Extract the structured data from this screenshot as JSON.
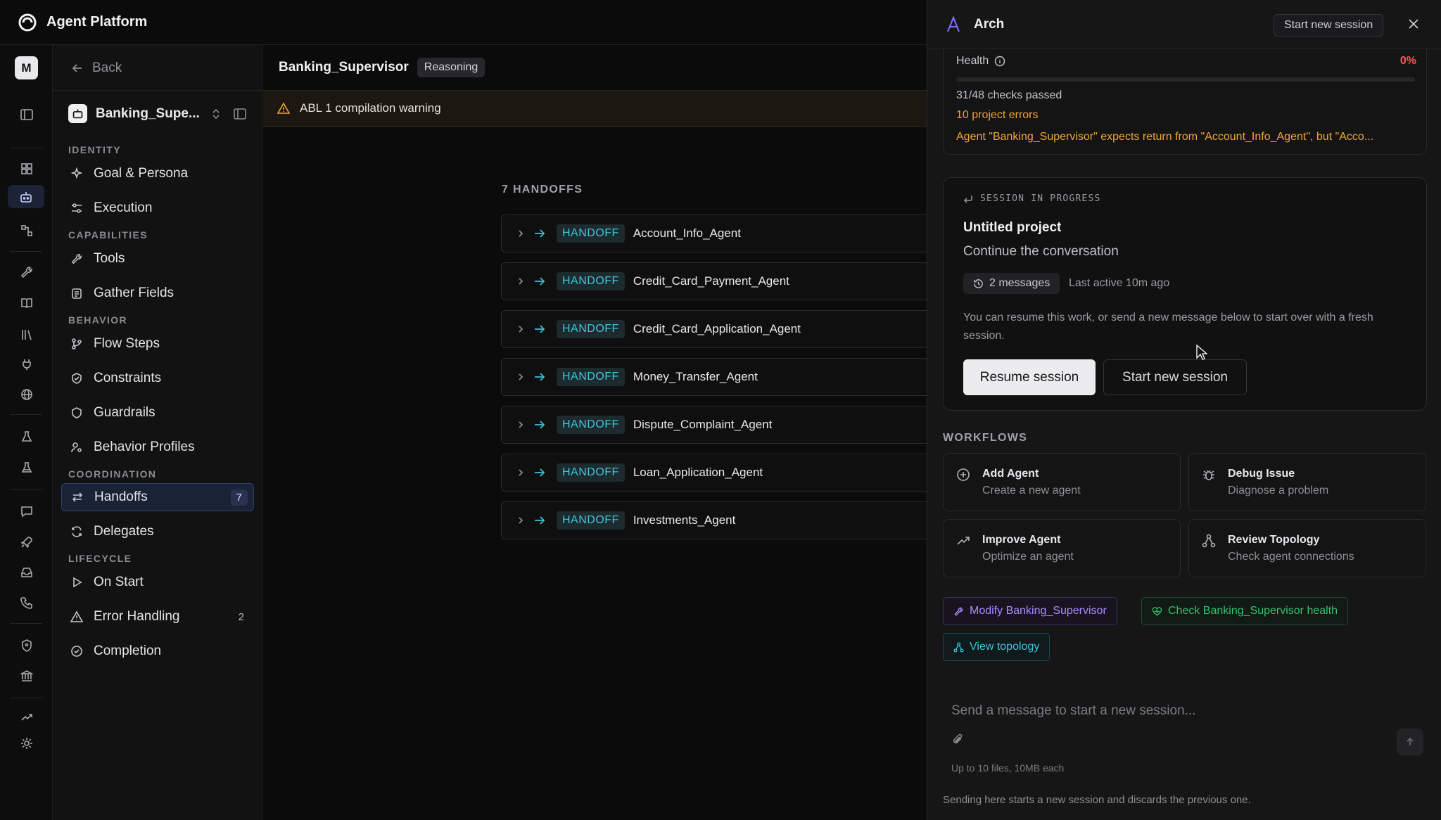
{
  "app": {
    "title": "Agent Platform"
  },
  "rail": {
    "avatar": "M"
  },
  "sidebar": {
    "back_label": "Back",
    "agent_name": "Banking_Supe...",
    "sections": {
      "identity": "IDENTITY",
      "capabilities": "CAPABILITIES",
      "behavior": "BEHAVIOR",
      "coordination": "COORDINATION",
      "lifecycle": "LIFECYCLE"
    },
    "items": {
      "goal": "Goal & Persona",
      "execution": "Execution",
      "tools": "Tools",
      "gather": "Gather Fields",
      "flow": "Flow Steps",
      "constraints": "Constraints",
      "guardrails": "Guardrails",
      "profiles": "Behavior Profiles",
      "handoffs": "Handoffs",
      "handoffs_count": "7",
      "delegates": "Delegates",
      "onstart": "On Start",
      "errors": "Error Handling",
      "errors_count": "2",
      "completion": "Completion"
    }
  },
  "main": {
    "title": "Banking_Supervisor",
    "badge": "Reasoning",
    "warning": "ABL 1 compilation warning",
    "handoff_count_label": "7 HANDOFFS",
    "tag_label": "HANDOFF",
    "handoffs": [
      "Account_Info_Agent",
      "Credit_Card_Payment_Agent",
      "Credit_Card_Application_Agent",
      "Money_Transfer_Agent",
      "Dispute_Complaint_Agent",
      "Loan_Application_Agent",
      "Investments_Agent"
    ]
  },
  "panel": {
    "title": "Arch",
    "start_new": "Start new session",
    "health": {
      "label": "Health",
      "percent": "0%",
      "checks": "31/48 checks passed",
      "errors": "10 project errors",
      "error_message": "Agent \"Banking_Supervisor\" expects return from \"Account_Info_Agent\", but \"Acco..."
    },
    "session": {
      "label": "SESSION IN PROGRESS",
      "project": "Untitled project",
      "subtitle": "Continue the conversation",
      "messages": "2 messages",
      "last_active": "Last active 10m ago",
      "description": "You can resume this work, or send a new message below to start over with a fresh session.",
      "resume": "Resume session",
      "start_new": "Start new session"
    },
    "workflows_label": "WORKFLOWS",
    "workflows": [
      {
        "title": "Add Agent",
        "sub": "Create a new agent",
        "icon": "plus-circle-icon"
      },
      {
        "title": "Debug Issue",
        "sub": "Diagnose a problem",
        "icon": "bug-icon"
      },
      {
        "title": "Improve Agent",
        "sub": "Optimize an agent",
        "icon": "trending-up-icon"
      },
      {
        "title": "Review Topology",
        "sub": "Check agent connections",
        "icon": "topology-icon"
      }
    ],
    "chips": {
      "modify": "Modify Banking_Supervisor",
      "health": "Check Banking_Supervisor health",
      "topology": "View topology"
    },
    "composer": {
      "placeholder": "Send a message to start a new session...",
      "limits": "Up to 10 files, 10MB each"
    },
    "footnote": "Sending here starts a new session and discards the previous one."
  },
  "colors": {
    "accent_cyan": "#3fc6da",
    "warning_orange": "#f0a531",
    "error_red": "#ff5a55",
    "purple": "#a98cff",
    "green": "#37c26e"
  }
}
